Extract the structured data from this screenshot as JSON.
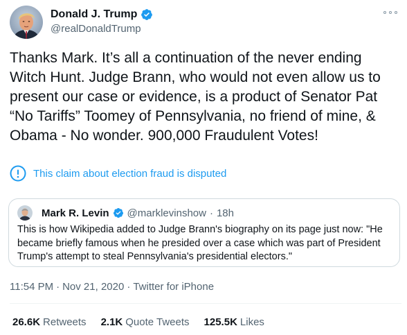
{
  "author": {
    "display_name": "Donald J. Trump",
    "handle": "@realDonaldTrump",
    "verified": true
  },
  "tweet": {
    "text": "Thanks Mark. It’s all a continuation of the never ending Witch Hunt. Judge Brann, who would not even allow us to present our case or evidence, is a product of Senator Pat “No Tariffs” Toomey of Pennsylvania, no friend of mine, & Obama - No wonder. 900,000 Fraudulent Votes!"
  },
  "notice": {
    "text": "This claim about election fraud is disputed"
  },
  "quoted_tweet": {
    "display_name": "Mark R. Levin",
    "handle": "@marklevinshow",
    "separator": "·",
    "time": "18h",
    "text": "This is how Wikipedia added to Judge Brann's biography on its page just now: \"He became briefly famous when he presided over a case which was part of President Trump's attempt to steal Pennsylvania's presidential electors.\""
  },
  "meta": {
    "time": "11:54 PM",
    "separator1": "·",
    "date": "Nov 21, 2020",
    "separator2": "·",
    "source": "Twitter for iPhone"
  },
  "stats": {
    "retweets": {
      "count": "26.6K",
      "label": "Retweets"
    },
    "quote_tweets": {
      "count": "2.1K",
      "label": "Quote Tweets"
    },
    "likes": {
      "count": "125.5K",
      "label": "Likes"
    }
  },
  "colors": {
    "accent": "#1d9bf0",
    "secondary_text": "#536471",
    "border": "#cfd9de"
  }
}
